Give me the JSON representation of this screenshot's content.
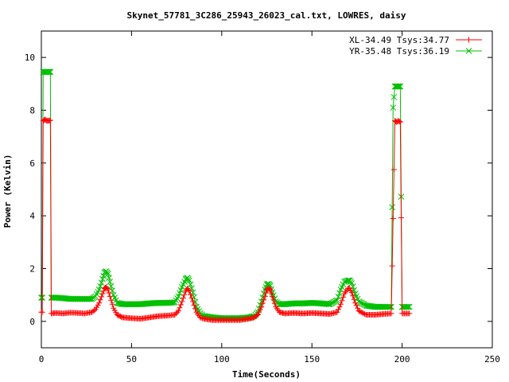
{
  "chart_data": {
    "type": "line",
    "title": "Skynet_57781_3C286_25943_26023_cal.txt, LOWRES, daisy",
    "xlabel": "Time(Seconds)",
    "ylabel": "Power (Kelvin)",
    "xlim": [
      0,
      250
    ],
    "ylim": [
      -1,
      11
    ],
    "xticks": [
      0,
      50,
      100,
      150,
      200,
      250
    ],
    "yticks": [
      0,
      2,
      4,
      6,
      8,
      10
    ],
    "grid": false,
    "legend_position": "top-right",
    "series": [
      {
        "name": "XL-34.49 Tsys:34.77",
        "color": "#ff0000",
        "marker": "plus",
        "points": [
          [
            0,
            0.35
          ],
          [
            0.5,
            0.35
          ],
          [
            1,
            7.6
          ],
          [
            2,
            7.65
          ],
          [
            3,
            7.6
          ],
          [
            4,
            7.6
          ],
          [
            5,
            7.62
          ],
          [
            5.5,
            0.3
          ],
          [
            8,
            0.32
          ],
          [
            12,
            0.3
          ],
          [
            16,
            0.33
          ],
          [
            20,
            0.32
          ],
          [
            24,
            0.3
          ],
          [
            28,
            0.35
          ],
          [
            30,
            0.45
          ],
          [
            32,
            0.7
          ],
          [
            34,
            1.05
          ],
          [
            35,
            1.25
          ],
          [
            36,
            1.3
          ],
          [
            37,
            1.2
          ],
          [
            38,
            0.95
          ],
          [
            40,
            0.5
          ],
          [
            42,
            0.25
          ],
          [
            45,
            0.15
          ],
          [
            50,
            0.12
          ],
          [
            55,
            0.1
          ],
          [
            60,
            0.15
          ],
          [
            65,
            0.2
          ],
          [
            70,
            0.22
          ],
          [
            74,
            0.25
          ],
          [
            76,
            0.4
          ],
          [
            78,
            0.75
          ],
          [
            80,
            1.15
          ],
          [
            81,
            1.25
          ],
          [
            82,
            1.15
          ],
          [
            84,
            0.75
          ],
          [
            86,
            0.35
          ],
          [
            88,
            0.15
          ],
          [
            90,
            0.1
          ],
          [
            95,
            0.05
          ],
          [
            100,
            0.05
          ],
          [
            105,
            0.05
          ],
          [
            110,
            0.05
          ],
          [
            115,
            0.1
          ],
          [
            118,
            0.15
          ],
          [
            120,
            0.25
          ],
          [
            122,
            0.55
          ],
          [
            124,
            0.95
          ],
          [
            125,
            1.2
          ],
          [
            126,
            1.25
          ],
          [
            127,
            1.2
          ],
          [
            128,
            0.95
          ],
          [
            130,
            0.55
          ],
          [
            132,
            0.35
          ],
          [
            135,
            0.3
          ],
          [
            140,
            0.32
          ],
          [
            145,
            0.3
          ],
          [
            150,
            0.32
          ],
          [
            155,
            0.3
          ],
          [
            160,
            0.28
          ],
          [
            164,
            0.35
          ],
          [
            166,
            0.65
          ],
          [
            168,
            1.05
          ],
          [
            170,
            1.25
          ],
          [
            171,
            1.25
          ],
          [
            172,
            1.1
          ],
          [
            174,
            0.7
          ],
          [
            176,
            0.4
          ],
          [
            180,
            0.25
          ],
          [
            185,
            0.25
          ],
          [
            190,
            0.28
          ],
          [
            194,
            0.3
          ],
          [
            195,
            3.9
          ],
          [
            196,
            7.6
          ],
          [
            197,
            7.55
          ],
          [
            198,
            7.6
          ],
          [
            199,
            7.55
          ],
          [
            200,
            0.3
          ],
          [
            202,
            0.3
          ],
          [
            204,
            0.3
          ]
        ]
      },
      {
        "name": "YR-35.48 Tsys:36.19",
        "color": "#00c000",
        "marker": "cross",
        "points": [
          [
            0,
            0.9
          ],
          [
            0.5,
            0.9
          ],
          [
            1,
            9.45
          ],
          [
            2,
            9.45
          ],
          [
            3,
            9.45
          ],
          [
            4,
            9.45
          ],
          [
            5,
            9.45
          ],
          [
            5.5,
            0.9
          ],
          [
            8,
            0.9
          ],
          [
            12,
            0.88
          ],
          [
            16,
            0.85
          ],
          [
            20,
            0.85
          ],
          [
            24,
            0.85
          ],
          [
            28,
            0.85
          ],
          [
            30,
            0.95
          ],
          [
            32,
            1.2
          ],
          [
            34,
            1.6
          ],
          [
            35,
            1.85
          ],
          [
            36,
            1.9
          ],
          [
            37,
            1.8
          ],
          [
            38,
            1.5
          ],
          [
            40,
            1.0
          ],
          [
            42,
            0.7
          ],
          [
            45,
            0.65
          ],
          [
            50,
            0.65
          ],
          [
            55,
            0.65
          ],
          [
            60,
            0.68
          ],
          [
            65,
            0.7
          ],
          [
            70,
            0.7
          ],
          [
            74,
            0.72
          ],
          [
            76,
            0.95
          ],
          [
            78,
            1.3
          ],
          [
            80,
            1.6
          ],
          [
            81,
            1.65
          ],
          [
            82,
            1.55
          ],
          [
            84,
            1.1
          ],
          [
            86,
            0.55
          ],
          [
            88,
            0.3
          ],
          [
            90,
            0.2
          ],
          [
            95,
            0.15
          ],
          [
            100,
            0.12
          ],
          [
            105,
            0.12
          ],
          [
            110,
            0.12
          ],
          [
            115,
            0.15
          ],
          [
            118,
            0.2
          ],
          [
            120,
            0.35
          ],
          [
            122,
            0.75
          ],
          [
            124,
            1.2
          ],
          [
            125,
            1.4
          ],
          [
            126,
            1.42
          ],
          [
            127,
            1.35
          ],
          [
            128,
            1.1
          ],
          [
            130,
            0.75
          ],
          [
            132,
            0.65
          ],
          [
            135,
            0.65
          ],
          [
            140,
            0.68
          ],
          [
            145,
            0.68
          ],
          [
            150,
            0.7
          ],
          [
            155,
            0.68
          ],
          [
            160,
            0.65
          ],
          [
            164,
            0.8
          ],
          [
            166,
            1.2
          ],
          [
            168,
            1.5
          ],
          [
            170,
            1.55
          ],
          [
            171,
            1.55
          ],
          [
            172,
            1.45
          ],
          [
            174,
            1.05
          ],
          [
            176,
            0.75
          ],
          [
            180,
            0.6
          ],
          [
            185,
            0.55
          ],
          [
            190,
            0.55
          ],
          [
            194,
            0.55
          ],
          [
            195,
            8.1
          ],
          [
            196,
            8.9
          ],
          [
            197,
            8.9
          ],
          [
            198,
            8.9
          ],
          [
            199,
            8.9
          ],
          [
            200,
            0.55
          ],
          [
            202,
            0.55
          ],
          [
            204,
            0.55
          ]
        ]
      }
    ]
  }
}
